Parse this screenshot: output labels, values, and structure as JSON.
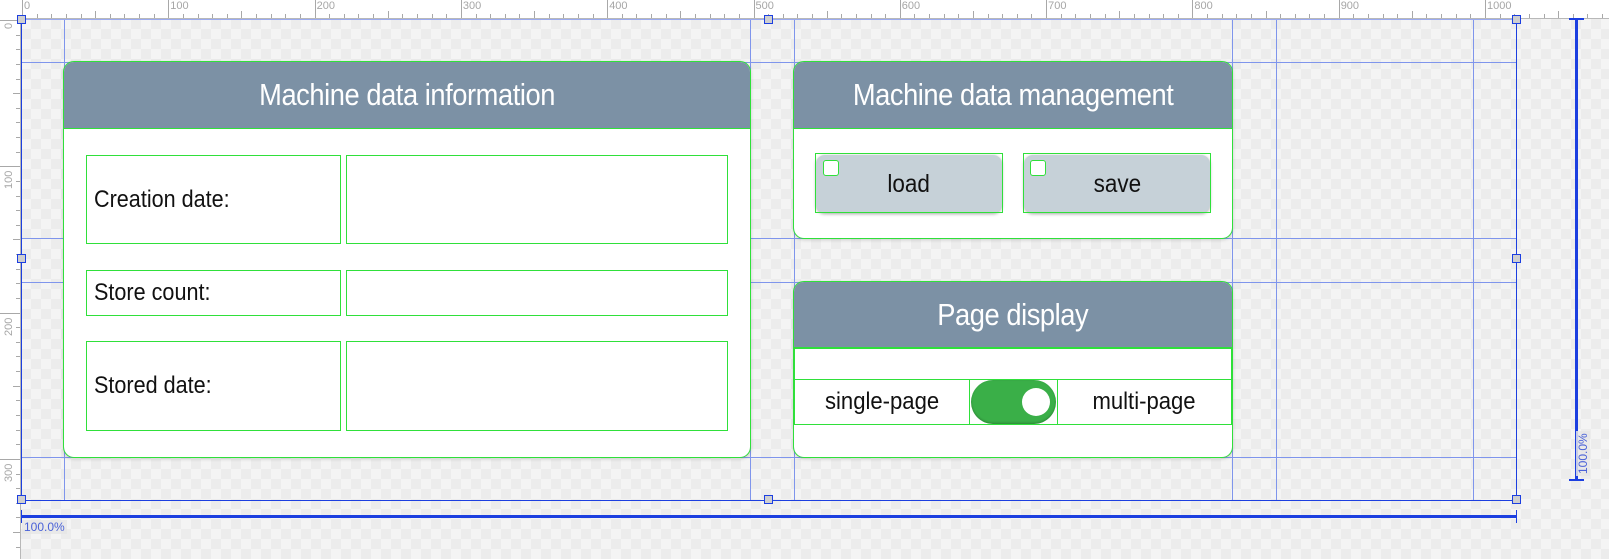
{
  "editor": {
    "ruler_top_labels": [
      "0",
      "100",
      "200",
      "300",
      "400",
      "500",
      "600",
      "700",
      "800",
      "900",
      "1000"
    ],
    "ruler_left_labels": [
      "0",
      "100",
      "200",
      "300"
    ],
    "width_percent": "100.0%",
    "height_percent": "100.0%"
  },
  "info_panel": {
    "title": "Machine data information",
    "fields": [
      {
        "label": "Creation date:",
        "value": ""
      },
      {
        "label": "Store count:",
        "value": ""
      },
      {
        "label": "Stored date:",
        "value": ""
      }
    ]
  },
  "management_panel": {
    "title": "Machine data management",
    "buttons": [
      {
        "label": "load"
      },
      {
        "label": "save"
      }
    ]
  },
  "display_panel": {
    "title": "Page display",
    "left_option": "single-page",
    "right_option": "multi-page",
    "toggle_on": true,
    "toggle_color": "#3aaf48"
  },
  "colors": {
    "header_bg": "#7c91a5",
    "button_bg": "#c6d1d8",
    "outline": "#2fe03a",
    "guide": "#7f95ec"
  }
}
